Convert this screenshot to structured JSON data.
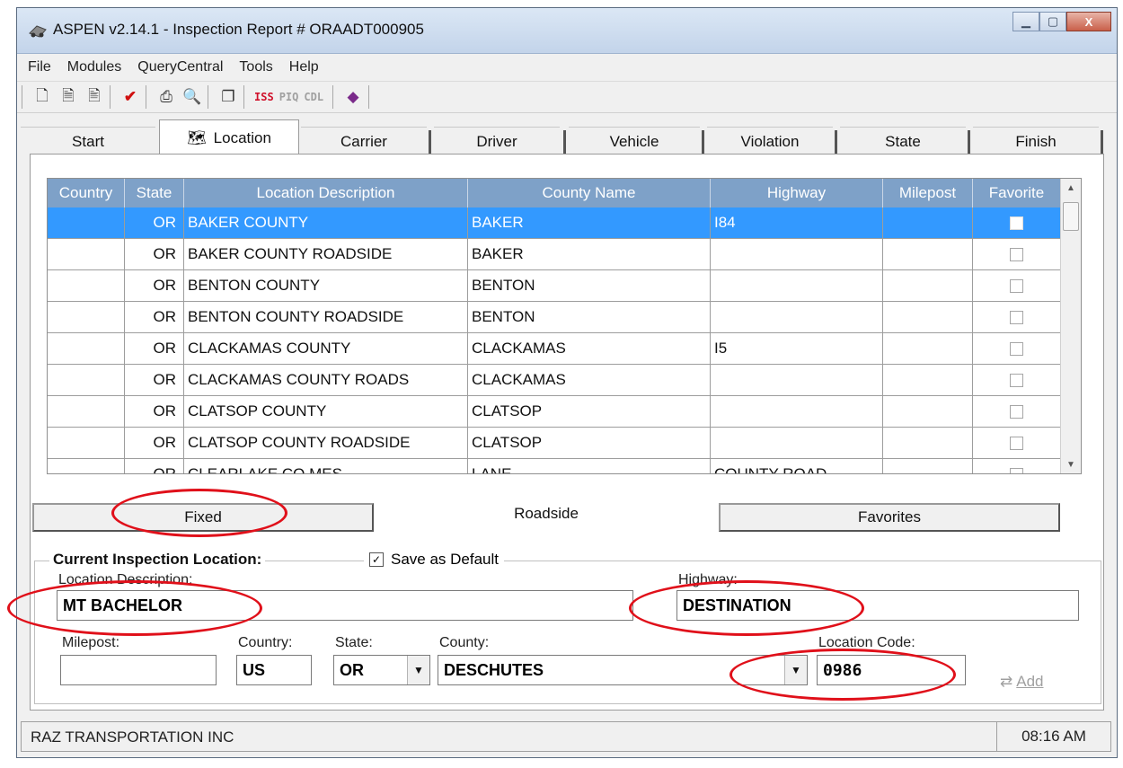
{
  "window": {
    "title": "ASPEN v2.14.1 - Inspection Report # ORAADT000905",
    "controls": {
      "minimize": "▁",
      "maximize": "▢",
      "close": "X"
    }
  },
  "menu": [
    "File",
    "Modules",
    "QueryCentral",
    "Tools",
    "Help"
  ],
  "toolbar": {
    "iss": "ISS",
    "piq": "PIQ",
    "cdl": "CDL"
  },
  "tabs": [
    "Start",
    "Location",
    "Carrier",
    "Driver",
    "Vehicle",
    "Violation",
    "State",
    "Finish"
  ],
  "grid": {
    "columns": [
      "Country",
      "State",
      "Location Description",
      "County Name",
      "Highway",
      "Milepost",
      "Favorite"
    ],
    "rows": [
      {
        "country": "",
        "state": "OR",
        "location": "BAKER COUNTY",
        "county": "BAKER",
        "highway": "I84",
        "milepost": ""
      },
      {
        "country": "",
        "state": "OR",
        "location": "BAKER COUNTY ROADSIDE",
        "county": "BAKER",
        "highway": "",
        "milepost": ""
      },
      {
        "country": "",
        "state": "OR",
        "location": "BENTON COUNTY",
        "county": "BENTON",
        "highway": "",
        "milepost": ""
      },
      {
        "country": "",
        "state": "OR",
        "location": "BENTON COUNTY ROADSIDE",
        "county": "BENTON",
        "highway": "",
        "milepost": ""
      },
      {
        "country": "",
        "state": "OR",
        "location": "CLACKAMAS COUNTY",
        "county": "CLACKAMAS",
        "highway": "I5",
        "milepost": ""
      },
      {
        "country": "",
        "state": "OR",
        "location": "CLACKAMAS COUNTY ROADS",
        "county": "CLACKAMAS",
        "highway": "",
        "milepost": ""
      },
      {
        "country": "",
        "state": "OR",
        "location": "CLATSOP COUNTY",
        "county": "CLATSOP",
        "highway": "",
        "milepost": ""
      },
      {
        "country": "",
        "state": "OR",
        "location": "CLATSOP COUNTY ROADSIDE",
        "county": "CLATSOP",
        "highway": "",
        "milepost": ""
      },
      {
        "country": "",
        "state": "OR",
        "location": "CLEARLAKE CO MES",
        "county": "LANE",
        "highway": "COUNTY ROAD",
        "milepost": ""
      }
    ]
  },
  "subtabs": {
    "fixed": "Fixed",
    "roadside": "Roadside",
    "favorites": "Favorites"
  },
  "location_form": {
    "legend": "Current Inspection Location:",
    "save_default": "Save as Default",
    "location_desc_label": "Location Description:",
    "location_desc_value": "MT BACHELOR",
    "highway_label": "Highway:",
    "highway_value": "DESTINATION",
    "milepost_label": "Milepost:",
    "milepost_value": "",
    "country_label": "Country:",
    "country_value": "US",
    "state_label": "State:",
    "state_value": "OR",
    "county_label": "County:",
    "county_value": "DESCHUTES",
    "location_code_label": "Location Code:",
    "location_code_value": "0986",
    "add_label": "Add"
  },
  "status": {
    "carrier": "RAZ TRANSPORTATION INC",
    "time": "08:16 AM"
  },
  "colors": {
    "grid_header": "#7ea1c8",
    "selection": "#3399ff",
    "annotation": "#e0101a"
  }
}
